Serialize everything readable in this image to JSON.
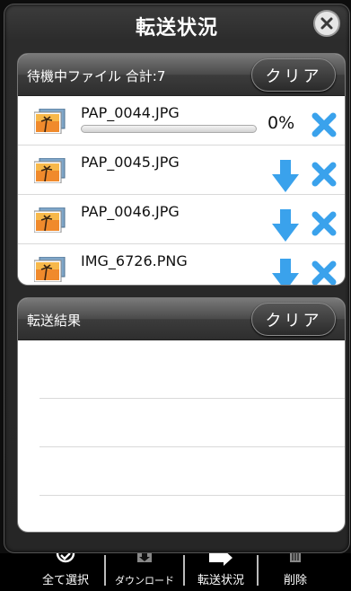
{
  "dialog": {
    "title": "転送状況"
  },
  "pending": {
    "header": "待機中ファイル 合計:7",
    "clear_label": "クリア",
    "files": [
      {
        "name": "PAP_0044.JPG",
        "status": "progress",
        "percent_text": "0%",
        "progress": 0
      },
      {
        "name": "PAP_0045.JPG",
        "status": "waiting"
      },
      {
        "name": "PAP_0046.JPG",
        "status": "waiting"
      },
      {
        "name": "IMG_6726.PNG",
        "status": "waiting"
      }
    ]
  },
  "results": {
    "header": "転送結果",
    "clear_label": "クリア"
  },
  "toolbar": {
    "items": [
      {
        "label": "全て選択",
        "icon": "check-circle-icon"
      },
      {
        "label": "ダウンロード",
        "icon": "download-icon"
      },
      {
        "label": "転送状況",
        "icon": "transfer-icon"
      },
      {
        "label": "削除",
        "icon": "trash-icon"
      }
    ]
  },
  "colors": {
    "accent_blue": "#3aa2ec",
    "panel_bg": "#2c2c2c"
  }
}
